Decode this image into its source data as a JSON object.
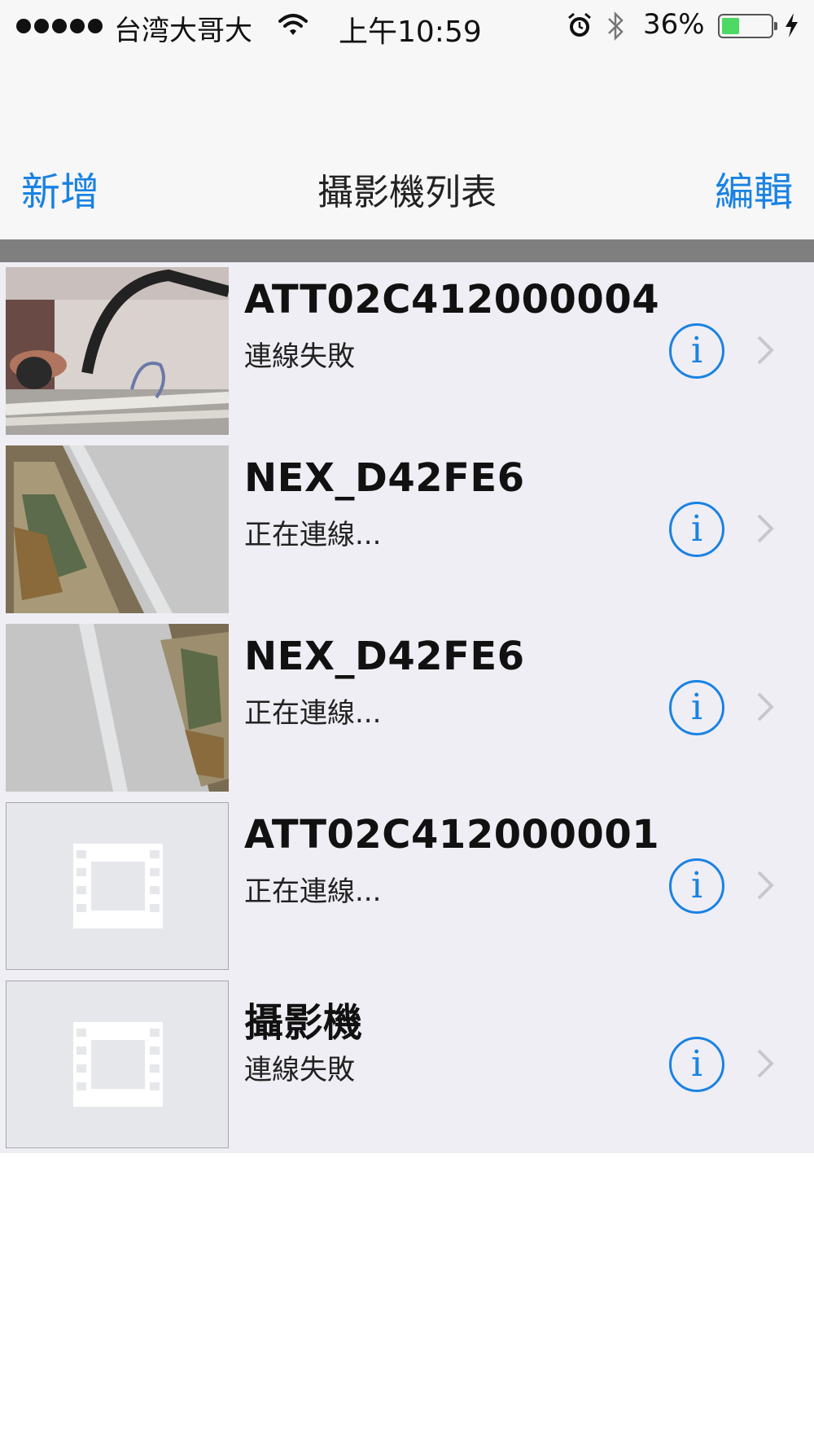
{
  "status_bar": {
    "carrier": "台湾大哥大",
    "time": "上午10:59",
    "battery_percent_text": "36%",
    "battery_level": 0.36,
    "battery_color": "#4cd964"
  },
  "nav": {
    "add_label": "新增",
    "title": "攝影機列表",
    "edit_label": "編輯",
    "accent_color": "#1a82e2"
  },
  "cameras": [
    {
      "name": "ATT02C412000004",
      "status": "連線失敗",
      "thumbnail": "photo"
    },
    {
      "name": "NEX_D42FE6",
      "status": "正在連線...",
      "thumbnail": "photo"
    },
    {
      "name": "NEX_D42FE6",
      "status": "正在連線...",
      "thumbnail": "photo"
    },
    {
      "name": "ATT02C412000001",
      "status": "正在連線...",
      "thumbnail": "film-placeholder-icon"
    },
    {
      "name": "攝影機",
      "status": "連線失敗",
      "thumbnail": "film-placeholder-icon"
    }
  ],
  "icons": {
    "info": "info-icon",
    "disclosure": "chevron-right-icon",
    "placeholder": "film-icon"
  }
}
